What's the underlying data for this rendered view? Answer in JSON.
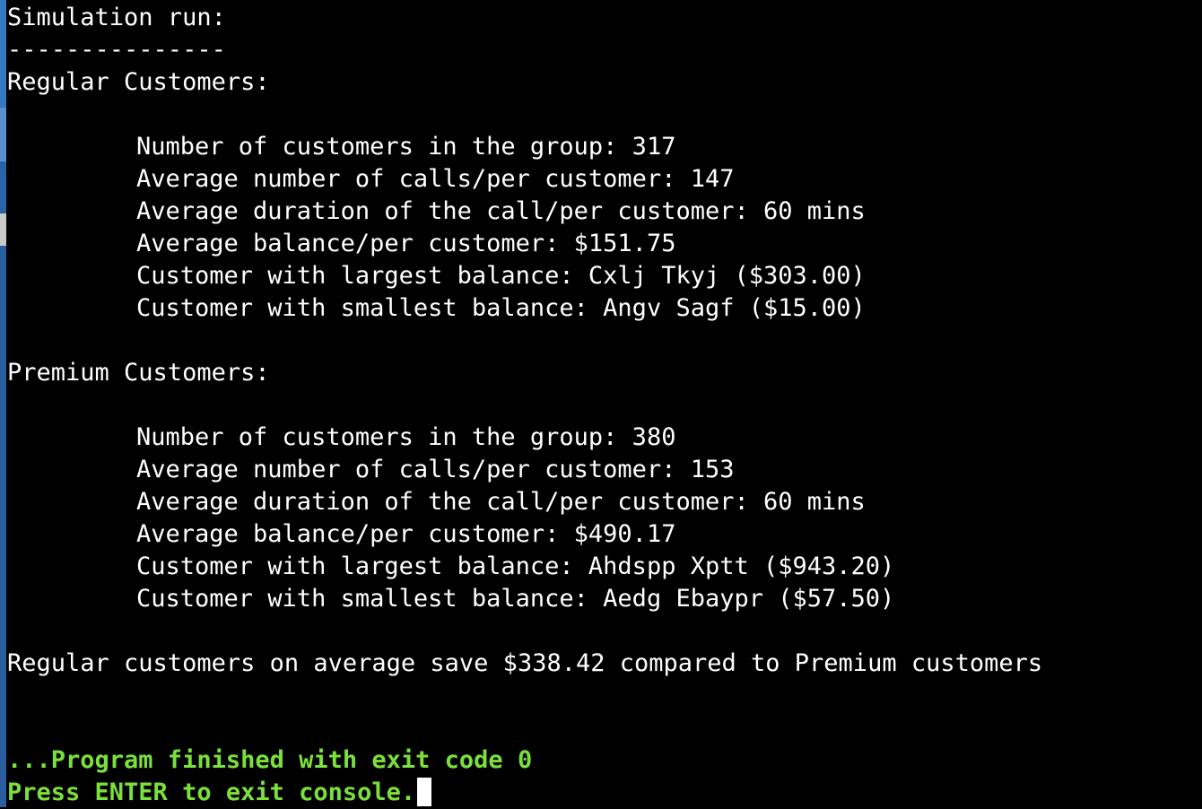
{
  "console": {
    "title": "Simulation run:",
    "separator": "---------------",
    "regular": {
      "header": "Regular Customers:",
      "lines": [
        "Number of customers in the group: 317",
        "Average number of calls/per customer: 147",
        "Average duration of the call/per customer: 60 mins",
        "Average balance/per customer: $151.75",
        "Customer with largest balance: Cxlj Tkyj ($303.00)",
        "Customer with smallest balance: Angv Sagf ($15.00)"
      ]
    },
    "premium": {
      "header": "Premium Customers:",
      "lines": [
        "Number of customers in the group: 380",
        "Average number of calls/per customer: 153",
        "Average duration of the call/per customer: 60 mins",
        "Average balance/per customer: $490.17",
        "Customer with largest balance: Ahdspp Xptt ($943.20)",
        "Customer with smallest balance: Aedg Ebaypr ($57.50)"
      ]
    },
    "summary": "Regular customers on average save $338.42 compared to Premium customers",
    "exit_message": "...Program finished with exit code 0",
    "prompt": "Press ENTER to exit console."
  },
  "colors": {
    "background": "#000000",
    "text": "#ffffff",
    "status_text": "#79e03c",
    "window_edge": "#2f6fb3"
  }
}
